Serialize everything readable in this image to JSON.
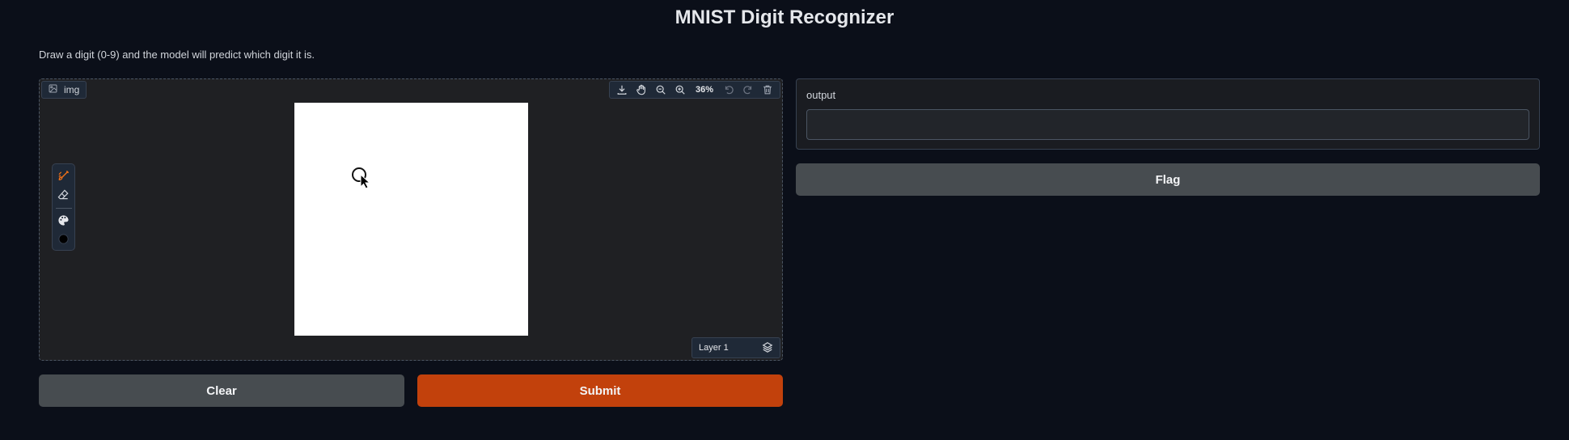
{
  "header": {
    "title": "MNIST Digit Recognizer",
    "description": "Draw a digit (0-9) and the model will predict which digit it is."
  },
  "input_panel": {
    "label": "img",
    "zoom_level": "36%",
    "layer_label": "Layer 1",
    "canvas_color": "#ffffff",
    "brush_color": "#000000",
    "toolbar_icons": [
      "download-icon",
      "pan-icon",
      "zoom-out-icon",
      "zoom-in-icon",
      "undo-icon",
      "redo-icon",
      "trash-icon"
    ],
    "side_tool_icons": [
      "brush-icon",
      "eraser-icon",
      "palette-icon",
      "color-swatch"
    ]
  },
  "output_panel": {
    "label": "output",
    "value": ""
  },
  "buttons": {
    "clear": "Clear",
    "submit": "Submit",
    "flag": "Flag"
  },
  "colors": {
    "background": "#0b0f19",
    "primary": "#c2410c",
    "secondary": "#474c50"
  }
}
